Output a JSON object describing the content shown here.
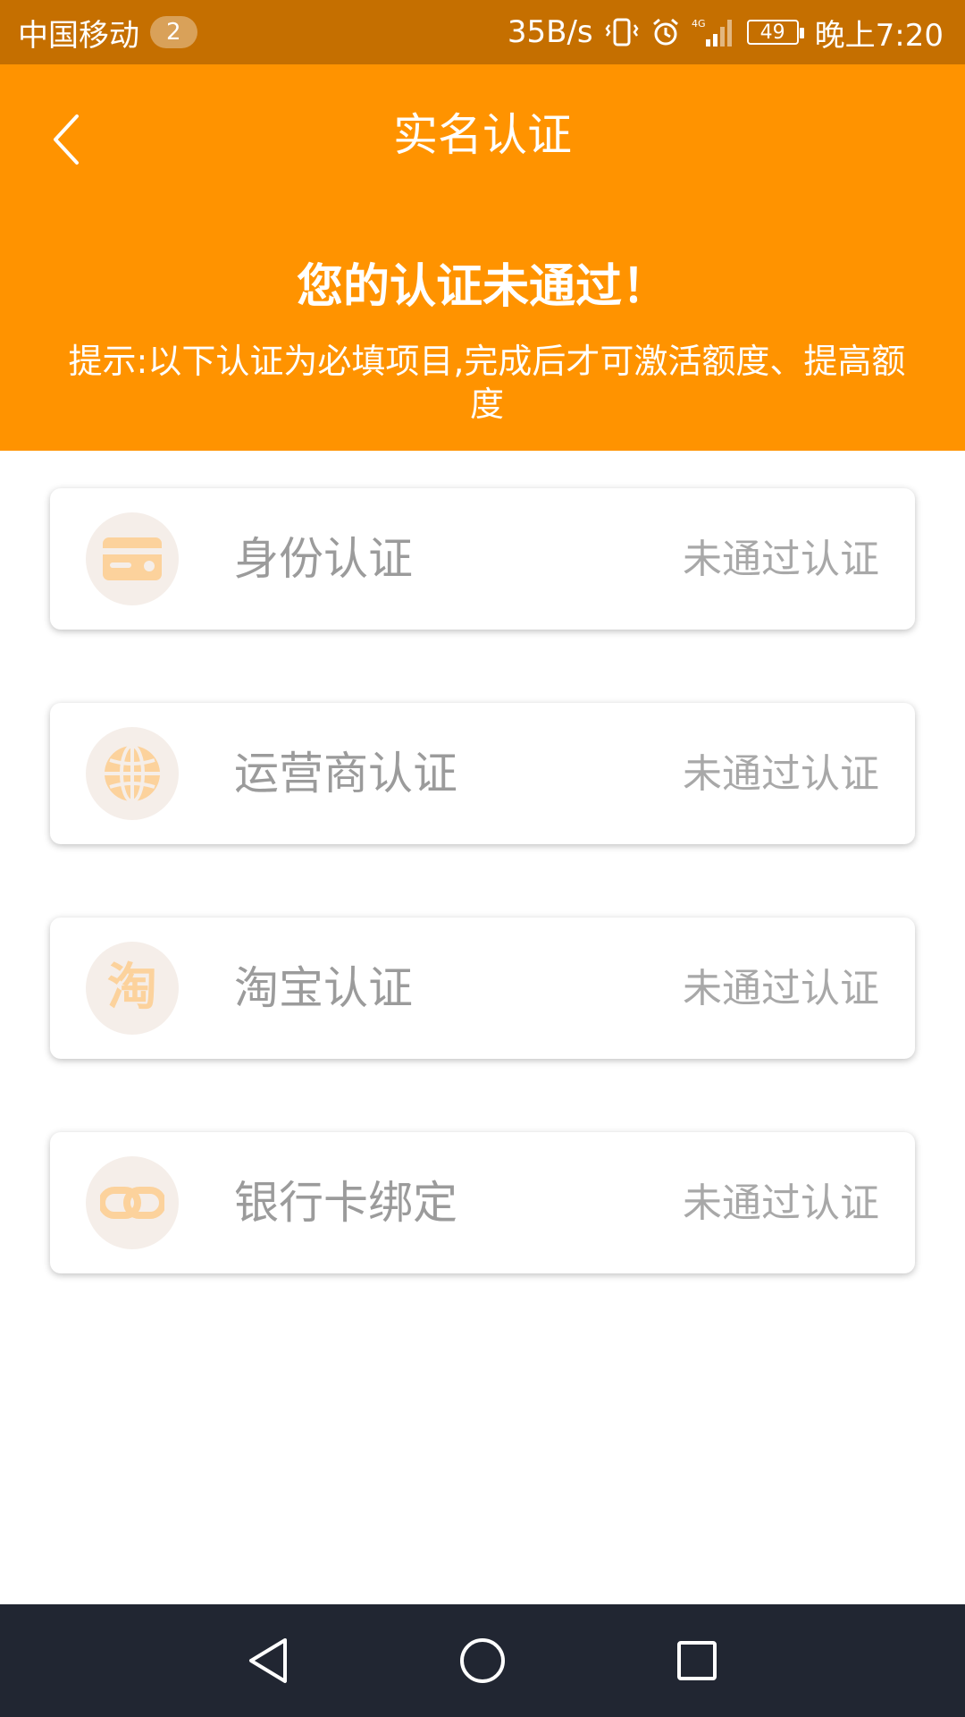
{
  "status_bar": {
    "carrier": "中国移动",
    "notification_count": "2",
    "network_speed": "35B/s",
    "battery_level": "49",
    "time": "晚上7:20",
    "icons": [
      "vibrate-icon",
      "alarm-icon",
      "4g-signal-icon",
      "battery-icon"
    ]
  },
  "header": {
    "title": "实名认证",
    "back_icon": "chevron-left-icon",
    "headline": "您的认证未通过！",
    "hint": "提示:以下认证为必填项目,完成后才可激活额度、提高额度"
  },
  "cards": [
    {
      "icon": "id-card-icon",
      "label": "身份认证",
      "status": "未通过认证"
    },
    {
      "icon": "globe-icon",
      "label": "运营商认证",
      "status": "未通过认证"
    },
    {
      "icon": "taobao-icon",
      "icon_glyph": "淘",
      "label": "淘宝认证",
      "status": "未通过认证"
    },
    {
      "icon": "link-icon",
      "label": "银行卡绑定",
      "status": "未通过认证"
    }
  ],
  "nav_bar": {
    "icons": [
      "back-triangle-icon",
      "home-circle-icon",
      "recents-square-icon"
    ]
  },
  "colors": {
    "status_bar": "#c56f00",
    "header": "#ff9300",
    "icon_fill": "#fcd29c",
    "icon_bg": "#f5eee9",
    "nav_bar": "#212632"
  }
}
